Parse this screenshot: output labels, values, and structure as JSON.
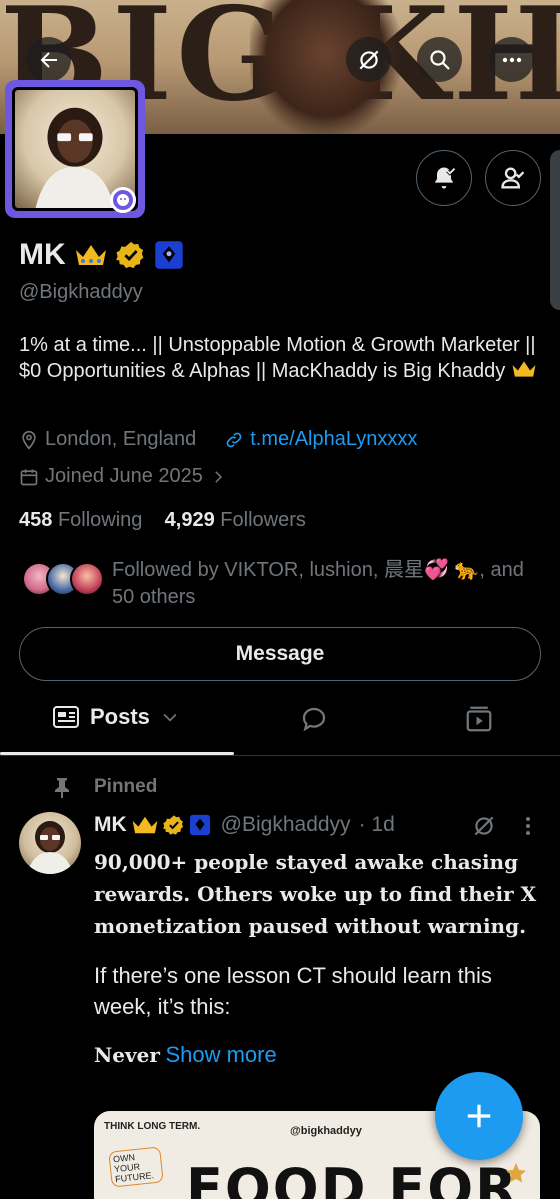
{
  "banner": {
    "text": "BIG KHADDYY"
  },
  "profile": {
    "name": "MK",
    "handle": "@Bigkhaddyy",
    "bio": "1% at a time... || Unstoppable Motion & Growth Marketer || $0 Opportunities & Alphas || MacKhaddy is Big Khaddy",
    "location": "London, England",
    "link": "t.me/AlphaLynxxxx",
    "joined": "Joined June 2025",
    "following_count": "458",
    "following_label": "Following",
    "followers_count": "4,929",
    "followers_label": "Followers",
    "followed_by": "Followed by VIKTOR, lushion, 晨星💞 🐆, and 50 others"
  },
  "actions": {
    "message": "Message"
  },
  "tabs": {
    "posts": "Posts"
  },
  "post": {
    "pinned_label": "Pinned",
    "name": "MK",
    "handle": "@Bigkhaddyy",
    "time": "· 1d",
    "bold_text": "90,000+ people stayed awake chasing rewards. Others woke up to find their X monetization paused without warning.",
    "paragraph": "If there’s one lesson CT should learn this week, it’s this:",
    "last_word": "Never",
    "show_more": "Show more",
    "media": {
      "handle": "@bigkhaddyy",
      "note1": "THINK LONG TERM.",
      "note2": "OWN YOUR FUTURE.",
      "title": "FOOD FOR"
    }
  },
  "colors": {
    "accent": "#1d9bf0",
    "avatar_frame": "#6e58e0",
    "gold_badge": "#e8b518",
    "affiliate_badge": "#1a3fd1"
  },
  "icons": [
    "back-arrow-icon",
    "grok-icon",
    "search-icon",
    "more-icon",
    "notifications-on-icon",
    "following-icon",
    "location-icon",
    "link-icon",
    "calendar-icon",
    "chevron-right-icon",
    "posts-icon",
    "chevron-down-icon",
    "replies-icon",
    "media-icon",
    "pin-icon",
    "compose-plus-icon"
  ]
}
